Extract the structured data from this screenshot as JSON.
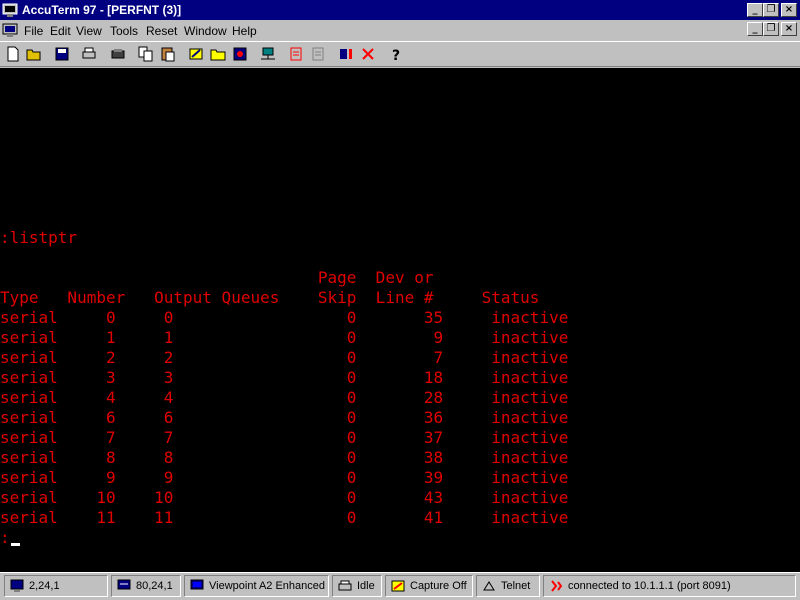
{
  "window": {
    "title": "AccuTerm 97 - [PERFNT (3)]"
  },
  "menu": [
    "File",
    "Edit",
    "View",
    "Tools",
    "Reset",
    "Window",
    "Help"
  ],
  "toolbar_icons": [
    "new-icon",
    "open-icon",
    "save-icon",
    "print-icon",
    "printer-setup-icon",
    "copy-icon",
    "paste-icon",
    "edit-icon",
    "folder-icon",
    "macro-icon",
    "network-icon",
    "capture-icon",
    "transfer-icon",
    "stop-icon",
    "disconnect-icon",
    "help-icon"
  ],
  "terminal": {
    "command": ":listptr",
    "header1": "                                 Page  Dev or",
    "header2": "Type   Number   Output Queues    Skip  Line #     Status",
    "rows": [
      "serial     0     0                  0       35     inactive",
      "serial     1     1                  0        9     inactive",
      "serial     2     2                  0        7     inactive",
      "serial     3     3                  0       18     inactive",
      "serial     4     4                  0       28     inactive",
      "serial     6     6                  0       36     inactive",
      "serial     7     7                  0       37     inactive",
      "serial     8     8                  0       38     inactive",
      "serial     9     9                  0       39     inactive",
      "serial    10    10                  0       43     inactive",
      "serial    11    11                  0       41     inactive"
    ],
    "prompt": ":"
  },
  "table": {
    "columns": [
      "Type",
      "Number",
      "Output Queues",
      "Page Skip",
      "Dev or Line #",
      "Status"
    ],
    "rows": [
      [
        "serial",
        "0",
        "0",
        "0",
        "35",
        "inactive"
      ],
      [
        "serial",
        "1",
        "1",
        "0",
        "9",
        "inactive"
      ],
      [
        "serial",
        "2",
        "2",
        "0",
        "7",
        "inactive"
      ],
      [
        "serial",
        "3",
        "3",
        "0",
        "18",
        "inactive"
      ],
      [
        "serial",
        "4",
        "4",
        "0",
        "28",
        "inactive"
      ],
      [
        "serial",
        "6",
        "6",
        "0",
        "36",
        "inactive"
      ],
      [
        "serial",
        "7",
        "7",
        "0",
        "37",
        "inactive"
      ],
      [
        "serial",
        "8",
        "8",
        "0",
        "38",
        "inactive"
      ],
      [
        "serial",
        "9",
        "9",
        "0",
        "39",
        "inactive"
      ],
      [
        "serial",
        "10",
        "10",
        "0",
        "43",
        "inactive"
      ],
      [
        "serial",
        "11",
        "11",
        "0",
        "41",
        "inactive"
      ]
    ]
  },
  "status": {
    "cursor_pos": "2,24,1",
    "screen_size": "80,24,1",
    "emulation": "Viewpoint A2 Enhanced",
    "printer": "Idle",
    "capture": "Capture Off",
    "protocol": "Telnet",
    "connection": "connected to 10.1.1.1 (port 8091)"
  },
  "colors": {
    "terminal_bg": "#000000",
    "terminal_fg": "#e00000",
    "titlebar": "#000080"
  }
}
